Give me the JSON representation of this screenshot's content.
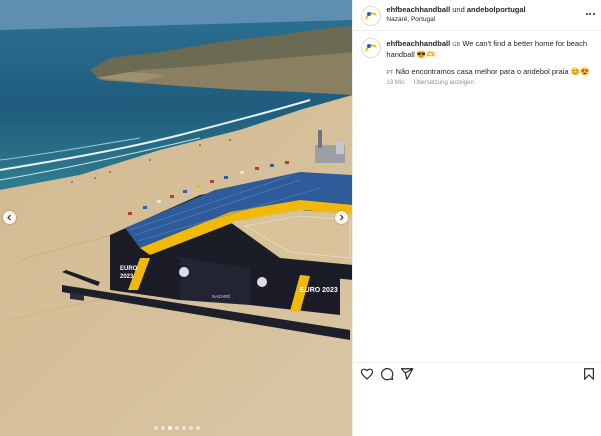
{
  "header": {
    "account_primary": "ehfbeachhandball",
    "connector": "und",
    "account_secondary": "andebolportugal",
    "location": "Nazaré, Portugal"
  },
  "caption": {
    "username": "ehfbeachhandball",
    "flag_en": "GB",
    "text_en": "We can't find a better home for beach handball 😎🫶",
    "flag_pt": "PT",
    "text_pt": "Não encontramos casa melhor para o andebol praia 😊😍",
    "time": "13 Min.",
    "translate_label": "Übersetzung anzeigen"
  },
  "media": {
    "banner_event": "EURO 2023",
    "banner_city": "NAZARÉ",
    "carousel_total": 7,
    "carousel_active": 3
  },
  "colors": {
    "accent_gold": "#f0b90b",
    "ocean": "#1e5d80",
    "sand": "#d9c39f"
  },
  "icons": {
    "like": "heart-icon",
    "comment": "comment-icon",
    "share": "paper-plane-icon",
    "save": "bookmark-icon",
    "more": "more-options-icon"
  }
}
